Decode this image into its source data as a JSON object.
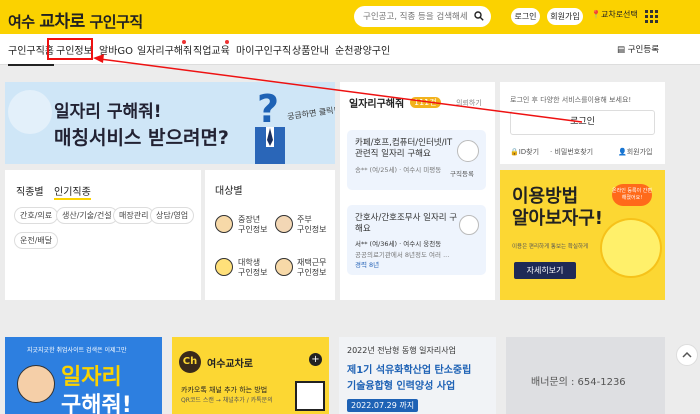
{
  "header": {
    "logo_prefix": "여수",
    "logo_brand": "교차로",
    "logo_suffix": "구인구직",
    "search_placeholder": "구인공고, 직종 등을 검색해세요",
    "login": "로그인",
    "signup": "회원가입",
    "location": "교차로선택"
  },
  "nav": {
    "items": [
      "구인구직홈",
      "구인정보",
      "알바GO",
      "일자리구해줘",
      "직업교육",
      "마이구인구직",
      "상품안내",
      "순천광양구인"
    ],
    "resume_register": "구인등록"
  },
  "banner_match": {
    "line1": "일자리 구해줘!",
    "line2": "매칭서비스 받으려면?",
    "aside": "궁금하면 클릭!"
  },
  "category": {
    "tab_job": "직종별",
    "tab_popular": "인기직종",
    "tags": [
      "간호/의료",
      "생산/기술/건설",
      "매장관리",
      "상담/영업",
      "운전/배달"
    ],
    "target_title": "대상별",
    "targets": [
      {
        "l1": "중장년",
        "l2": "구인정보"
      },
      {
        "l1": "주부",
        "l2": "구인정보"
      },
      {
        "l1": "대학생",
        "l2": "구인정보"
      },
      {
        "l1": "재택근무",
        "l2": "구인정보"
      }
    ]
  },
  "jobs": {
    "title": "일자리구해줘",
    "count": "111건",
    "more": "의뢰하기",
    "cards": [
      {
        "t1": "카페/호프,컴퓨터/인터넷/IT",
        "t2": "관련직 일자리 구해요",
        "who": "송** (여/25세)",
        "where": "여수시 미평동",
        "badge": "구직등록"
      },
      {
        "t1": "간호사/간호조무사 일자리 구",
        "t2": "해요",
        "who": "서** (여/36세)",
        "where": "여수시 웅천동",
        "desc": "공공의료기관에서 8년정도 여러 ...",
        "exp": "경력 8년"
      }
    ]
  },
  "login_box": {
    "text": "로그인 후 다양한 서비스를이용해 보세요!",
    "button": "로그인",
    "find_id": "ID찾기",
    "find_pw": "비밀번호찾기",
    "join": "회원가입"
  },
  "howto": {
    "line1": "이용방법",
    "line2": "알아보자구!",
    "bubble": "온라인 등록이 간편해졌어요!",
    "sub": "이용은 편리하게 통보는 확실하게",
    "button": "자세히보기"
  },
  "bottom": {
    "card1_small": "지긋지긋한 취업사이트 검색은 이제그만",
    "card1_big1": "일자리",
    "card1_big2": "구해줘!",
    "card2_badge": "Ch",
    "card2_title": "여수교차로",
    "card2_line1": "카카오톡 채널 추가 하는 방법",
    "card2_line2": "QR코드 스캔 → 채널추가 / 카톡문의",
    "card3_top": "2022년 전남형 동행 일자리사업",
    "card3_l1": "제1기 석유화학산업 탄소중립",
    "card3_l2": "기술융합형 인력양성 사업",
    "card3_date": "2022.07.29 까지",
    "card4_text": "배너문의 : 654-1236"
  },
  "colors": {
    "brand_yellow": "#fbd200",
    "highlight_red": "#e11111",
    "navy": "#1f2a56"
  }
}
